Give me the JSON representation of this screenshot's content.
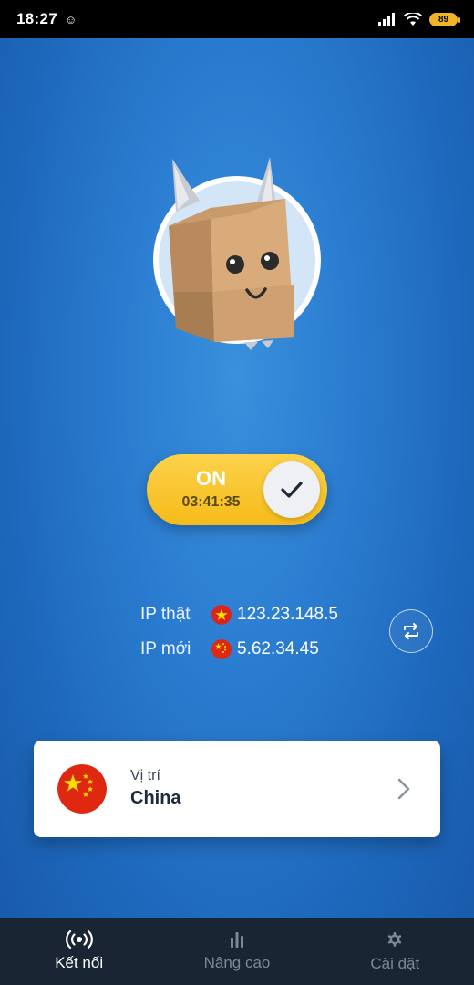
{
  "status_bar": {
    "time": "18:27",
    "battery": "89"
  },
  "connection": {
    "state_label": "ON",
    "timer": "03:41:35"
  },
  "ip_info": {
    "real_ip_label": "IP thật",
    "real_ip_value": "123.23.148.5",
    "new_ip_label": "IP mới",
    "new_ip_value": "5.62.34.45"
  },
  "location": {
    "label": "Vị trí",
    "value": "China"
  },
  "bottom_nav": {
    "items": [
      {
        "label": "Kết nối",
        "icon": "broadcast-icon",
        "active": true
      },
      {
        "label": "Nâng cao",
        "icon": "bar-chart-icon",
        "active": false
      },
      {
        "label": "Cài đặt",
        "icon": "gear-icon",
        "active": false
      }
    ]
  },
  "colors": {
    "background": "#2a7cd0",
    "toggle": "#f6bb1a",
    "nav_background": "#1a2533",
    "flag_red": "#de2910",
    "flag_star": "#ffde00"
  }
}
